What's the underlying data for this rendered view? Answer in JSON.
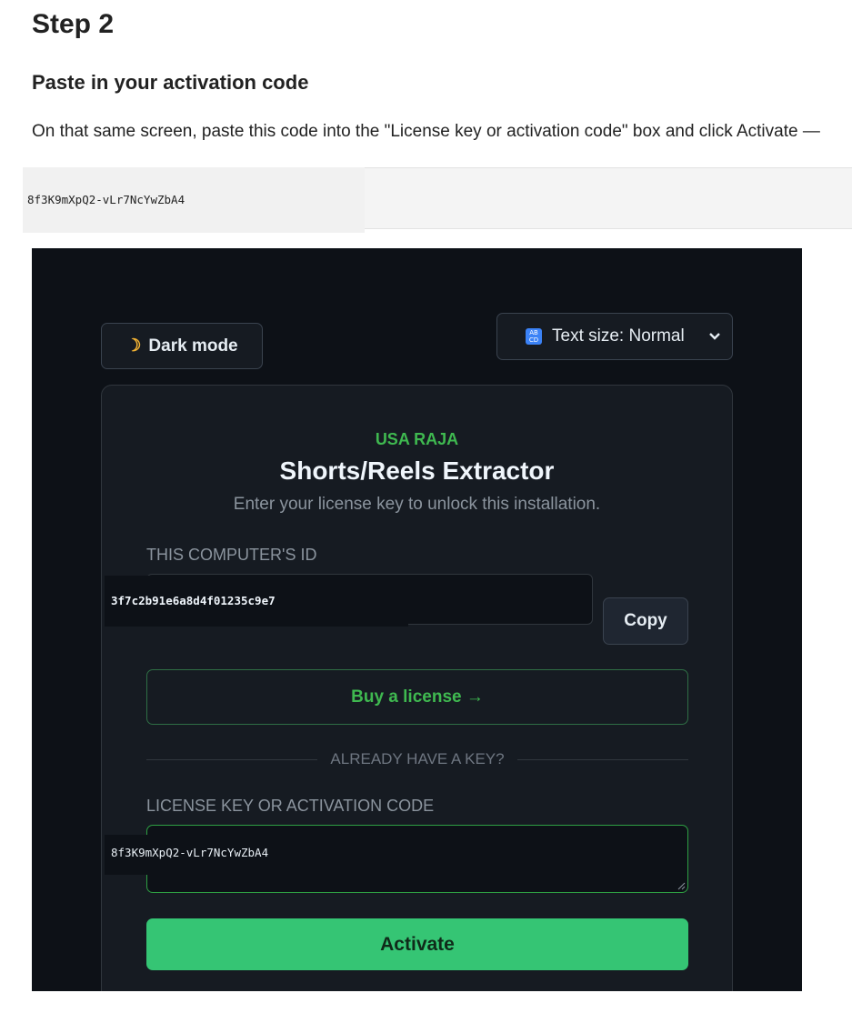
{
  "doc": {
    "step_title": "Step 2",
    "heading": "Paste in your activation code",
    "instructions": "On that same screen, paste this code into the \"License key or activation code\" box and click Activate —",
    "code": "8f3K9mXpQ2-vLr7NcYwZbA4"
  },
  "app": {
    "dark_mode_icon": "moon-icon",
    "dark_mode_label": "Dark mode",
    "text_size_icon": "abcd-icon",
    "text_size_label": "Text size: Normal",
    "brand": "USA RAJA",
    "title": "Shorts/Reels Extractor",
    "subtitle": "Enter your license key to unlock this installation.",
    "computer_id_label": "THIS COMPUTER'S ID",
    "computer_id": "3f7c2b91e6a8d4f01235c9e7",
    "copy_label": "Copy",
    "buy_label": "Buy a license →",
    "divider_text": "ALREADY HAVE A KEY?",
    "license_label": "LICENSE KEY OR ACTIVATION CODE",
    "license_value": "8f3K9mXpQ2-vLr7NcYwZbA4",
    "activate_label": "Activate"
  },
  "colors": {
    "app_background": "#0d1117",
    "card_background": "#161b22",
    "accent_green": "#3fb950",
    "activate_button": "#35c574"
  }
}
